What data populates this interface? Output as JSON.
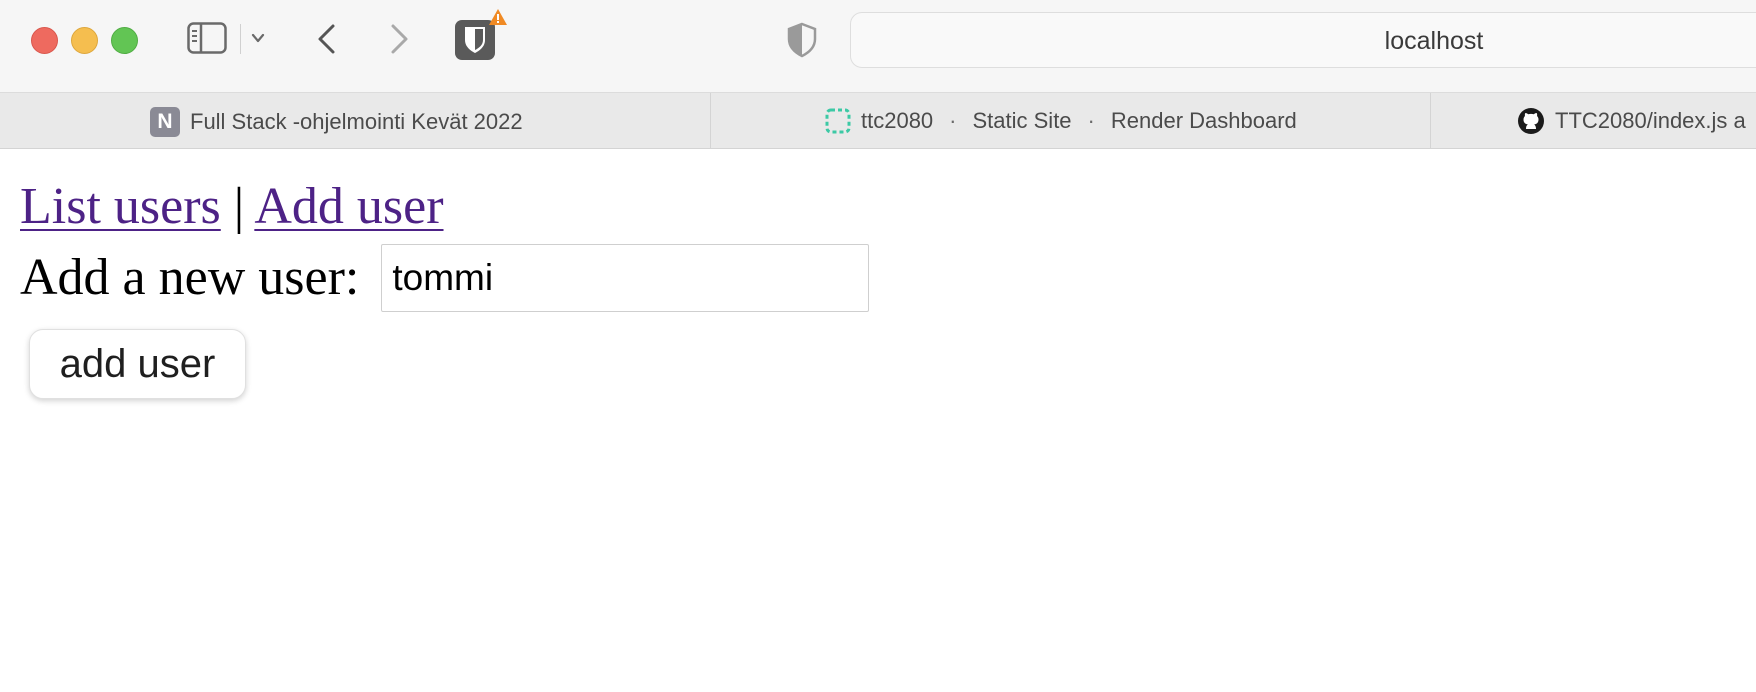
{
  "browser": {
    "address": "localhost",
    "tabs": [
      {
        "title": "Full Stack -ohjelmointi Kevät 2022",
        "icon": "n-icon"
      },
      {
        "title_parts": [
          "ttc2080",
          "Static Site",
          "Render Dashboard"
        ],
        "separator": "·",
        "icon": "render-icon"
      },
      {
        "title": "TTC2080/index.js a",
        "icon": "github-icon"
      }
    ],
    "favicon_letter": "N"
  },
  "page": {
    "nav": {
      "list_users": "List users",
      "separator": "|",
      "add_user": "Add user"
    },
    "form": {
      "label": "Add a new user:",
      "input_value": "tommi",
      "button_label": "add user"
    }
  },
  "colors": {
    "link_visited": "#4d2286",
    "close": "#ee6a5f",
    "minimize": "#f5be4f",
    "zoom": "#62c554"
  }
}
